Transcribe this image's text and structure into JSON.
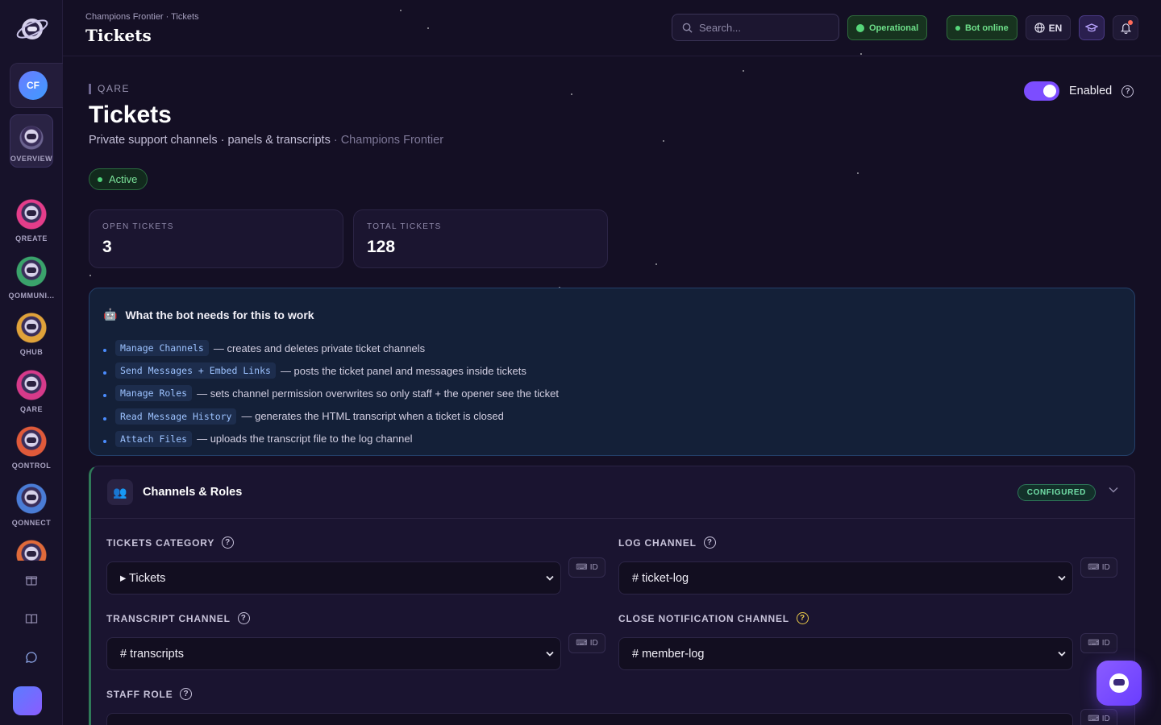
{
  "header": {
    "breadcrumb": "Champions Frontier · Tickets",
    "title": "Tickets",
    "search_placeholder": "Search...",
    "status_operational": "Operational",
    "status_bot": "Bot online",
    "language": "EN"
  },
  "sidebar": {
    "guild_initials": "CF",
    "items": [
      {
        "label": "OVERVIEW"
      },
      {
        "label": "QREATE"
      },
      {
        "label": "QOMMUNI..."
      },
      {
        "label": "QHUB"
      },
      {
        "label": "QARE"
      },
      {
        "label": "QONTROL"
      },
      {
        "label": "QONNECT"
      }
    ]
  },
  "page": {
    "eyebrow": "QARE",
    "title": "Tickets",
    "subtitle": "Private support channels · panels & transcripts",
    "subtitle_server": " · Champions Frontier",
    "status": "Active",
    "enabled_label": "Enabled"
  },
  "stats": [
    {
      "label": "OPEN TICKETS",
      "value": "3"
    },
    {
      "label": "TOTAL TICKETS",
      "value": "128"
    }
  ],
  "requirements": {
    "title": "What the bot needs for this to work",
    "items": [
      {
        "perm": "Manage Channels",
        "desc": "— creates and deletes private ticket channels"
      },
      {
        "perm": "Send Messages + Embed Links",
        "desc": "— posts the ticket panel and messages inside tickets"
      },
      {
        "perm": "Manage Roles",
        "desc": "— sets channel permission overwrites so only staff + the opener see the ticket"
      },
      {
        "perm": "Read Message History",
        "desc": "— generates the HTML transcript when a ticket is closed"
      },
      {
        "perm": "Attach Files",
        "desc": "— uploads the transcript file to the log channel"
      }
    ]
  },
  "section": {
    "title": "Channels & Roles",
    "badge": "CONFIGURED",
    "id_label": "ID",
    "fields": [
      {
        "label": "TICKETS CATEGORY",
        "value": "▸ Tickets"
      },
      {
        "label": "LOG CHANNEL",
        "value": "# ticket-log"
      },
      {
        "label": "TRANSCRIPT CHANNEL",
        "value": "# transcripts"
      },
      {
        "label": "CLOSE NOTIFICATION CHANNEL",
        "value": "# member-log"
      },
      {
        "label": "STAFF ROLE",
        "value": ""
      }
    ]
  },
  "colors": {
    "accent": "#7c4dff",
    "success": "#56d67a",
    "info": "#4a8cff"
  }
}
